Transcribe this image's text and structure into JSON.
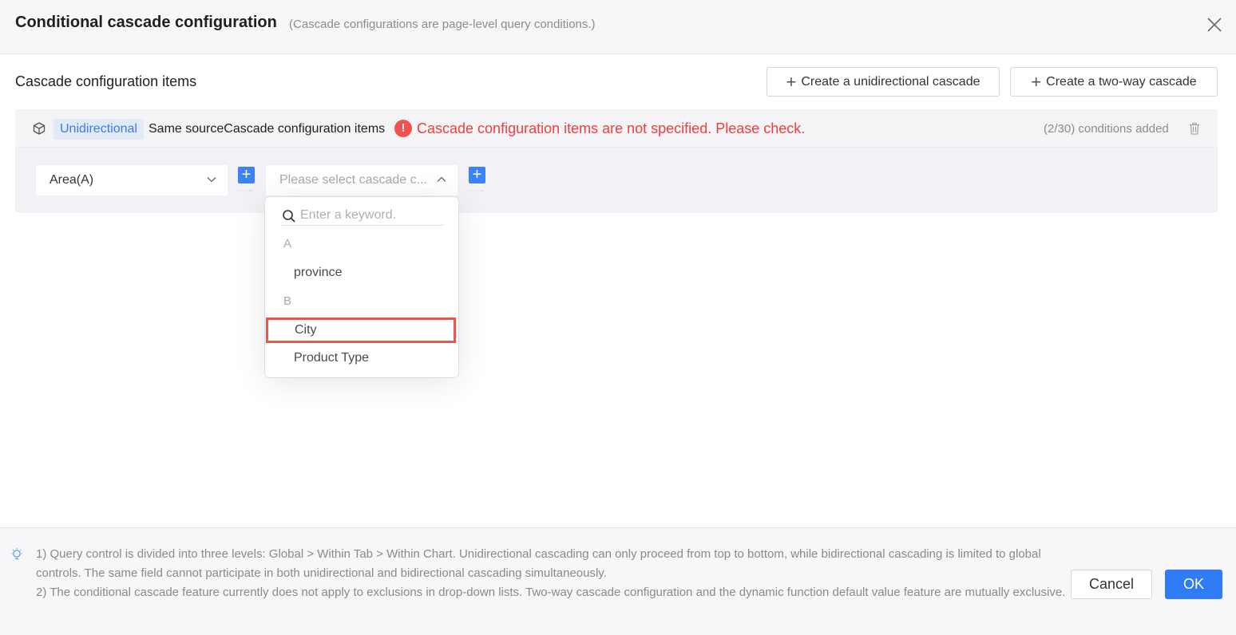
{
  "header": {
    "title": "Conditional cascade configuration",
    "subtitle": "(Cascade configurations are page-level query conditions.)",
    "close_icon": "close-icon"
  },
  "section": {
    "title": "Cascade configuration items",
    "btn_unidirectional": "Create a unidirectional cascade",
    "btn_two_way": "Create a two-way cascade"
  },
  "card": {
    "tag": "Unidirectional",
    "same_source": "Same sourceCascade configuration items",
    "error": "Cascade configuration items are not specified. Please check.",
    "error_icon": "!",
    "count": "(2/30) conditions added",
    "select_area": "Area(A)",
    "select_cascade_placeholder": "Please select cascade c...",
    "plus": "+"
  },
  "dropdown": {
    "search_placeholder": "Enter a keyword.",
    "groups": [
      {
        "label": "A",
        "items": [
          "province"
        ]
      },
      {
        "label": "B",
        "items": [
          "City",
          "Product Type"
        ]
      }
    ],
    "highlighted_item": "City"
  },
  "footer": {
    "note_1": "1) Query control is divided into three levels: Global > Within Tab > Within Chart. Unidirectional cascading can only proceed from top to bottom, while bidirectional cascading is limited to global controls. The same field cannot participate in both unidirectional and bidirectional cascading simultaneously.",
    "note_2": "2) The conditional cascade feature currently does not apply to exclusions in drop-down lists. Two-way cascade configuration and the dynamic function default value feature are mutually exclusive.",
    "cancel": "Cancel",
    "ok": "OK"
  },
  "colors": {
    "primary": "#2f7cf6",
    "error": "#f03e3e",
    "highlight_border": "#e8584a",
    "tag_bg": "#e2e9f7"
  }
}
